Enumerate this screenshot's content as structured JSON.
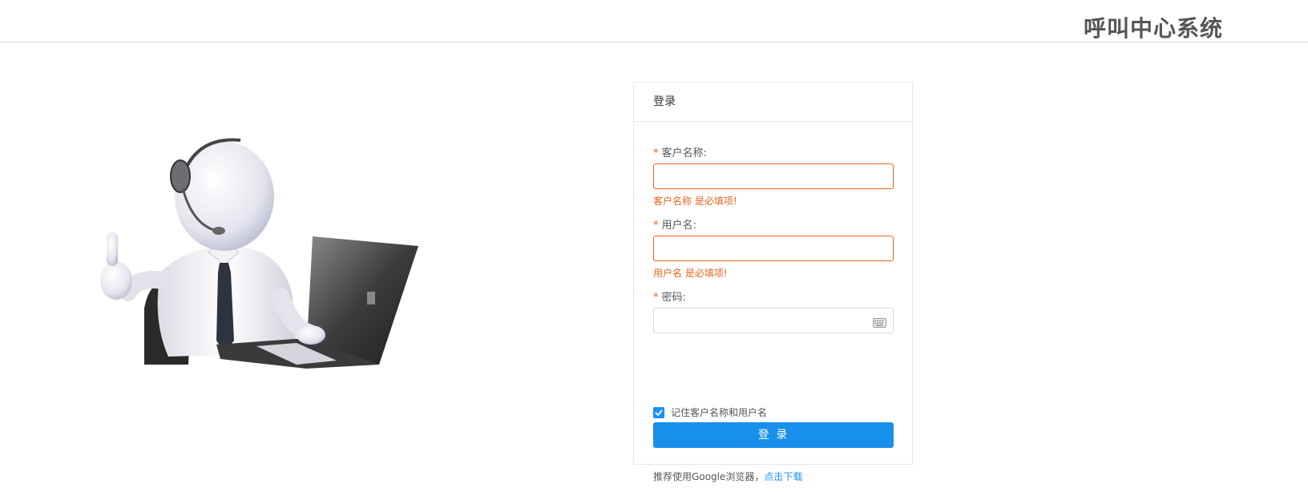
{
  "header": {
    "system_title": "呼叫中心系统"
  },
  "login": {
    "panel_title": "登录",
    "customer_name": {
      "label": "客户名称:",
      "value": "",
      "error": "客户名称 是必填项!"
    },
    "username": {
      "label": "用户名:",
      "value": "",
      "error": "用户名 是必填项!"
    },
    "password": {
      "label": "密码:",
      "value": "",
      "icon": "keyboard-icon"
    },
    "required_mark": "*",
    "remember": {
      "label": "记住客户名称和用户名",
      "checked": true
    },
    "submit_label": "登 录",
    "recommend_text": "推荐使用Google浏览器，",
    "download_link": "点击下载"
  },
  "colors": {
    "primary": "#1890eb",
    "error": "#e6631e"
  }
}
